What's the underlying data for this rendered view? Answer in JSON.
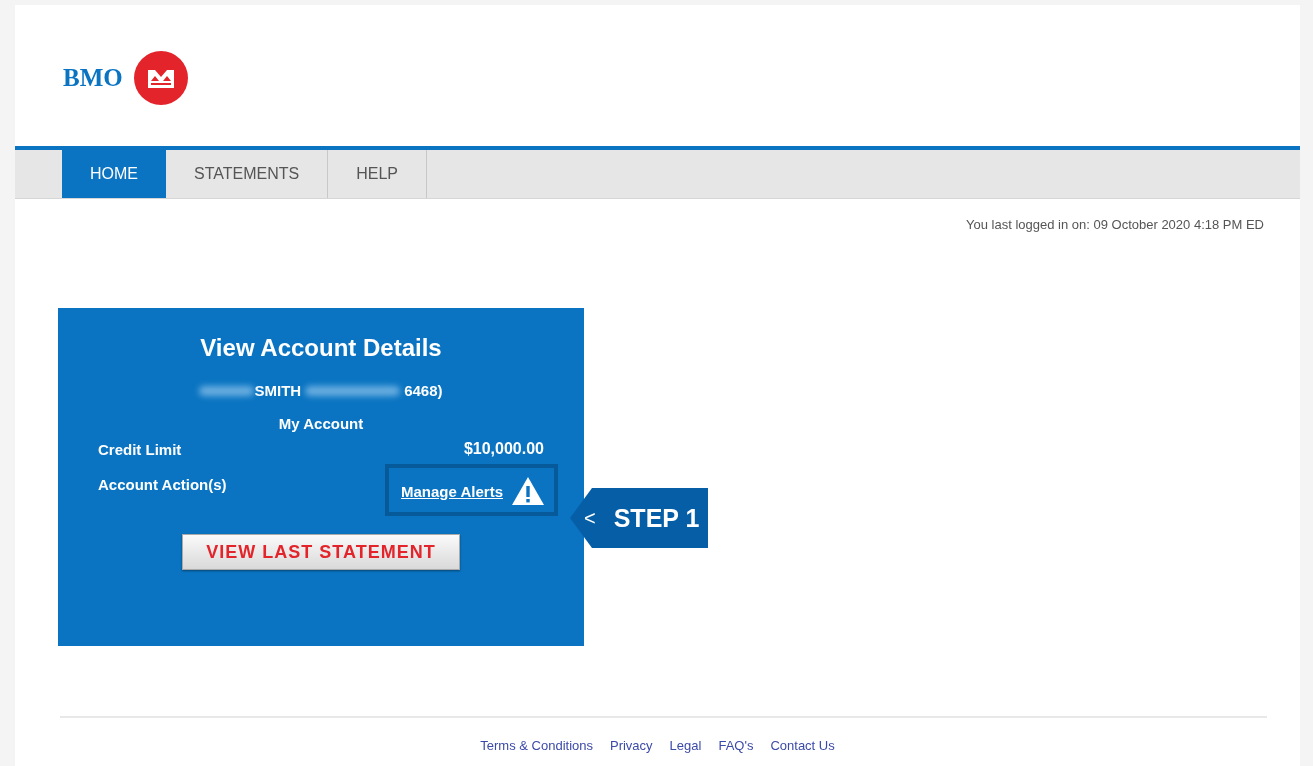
{
  "logo": {
    "text": "BMO"
  },
  "tabs": [
    {
      "label": "HOME",
      "selected": true
    },
    {
      "label": "STATEMENTS",
      "selected": false
    },
    {
      "label": "HELP",
      "selected": false
    }
  ],
  "last_login": "You last logged in on: 09 October 2020 4:18 PM ED",
  "account_card": {
    "title": "View Account Details",
    "holder_name": "SMITH",
    "account_suffix": "6468)",
    "account_name": "My Account",
    "credit_limit_label": "Credit Limit",
    "credit_limit": "$10,000.00",
    "actions_label": "Account Action(s)",
    "action_link": "Manage Alerts",
    "button": "VIEW LAST STATEMENT"
  },
  "callout": {
    "arrow": "<",
    "label": "STEP 1"
  },
  "footer_links": [
    "Terms & Conditions",
    "Privacy",
    "Legal",
    "FAQ's",
    "Contact Us"
  ]
}
